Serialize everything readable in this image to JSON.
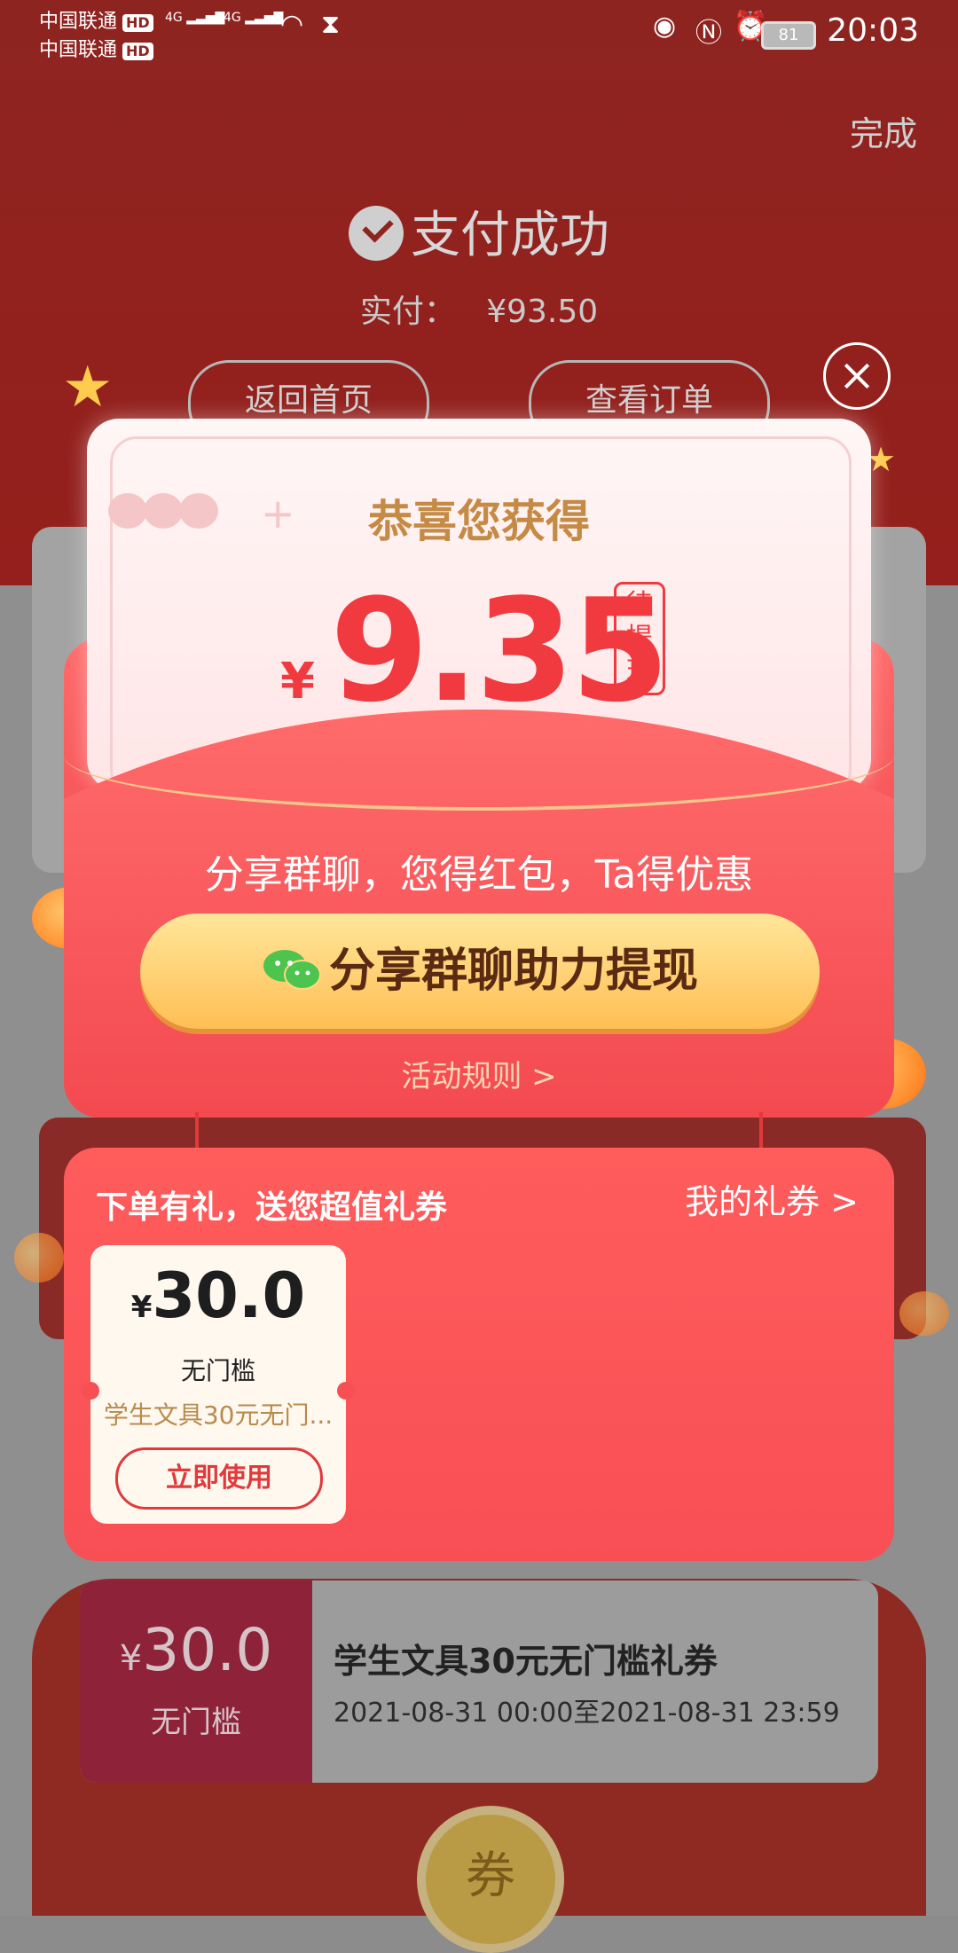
{
  "status_bar": {
    "carrier1": "中国联通",
    "carrier2": "中国联通",
    "hd": "HD",
    "network1": "4G",
    "network2": "4G",
    "battery": "81",
    "time": "20:03"
  },
  "header": {
    "done": "完成",
    "title": "支付成功",
    "paid_label": "实付：",
    "paid_amount": "¥93.50",
    "home_button": "返回首页",
    "order_button": "查看订单"
  },
  "popup": {
    "congrats": "恭喜您获得",
    "currency": "¥",
    "amount": "9.35",
    "pending_tag": "待提现",
    "share_text": "分享群聊，您得红包，Ta得优惠",
    "share_button": "分享群聊助力提现",
    "rules_link": "活动规则 >"
  },
  "gift": {
    "title": "下单有礼，送您超值礼券",
    "my_coupons": "我的礼券 >",
    "ticket": {
      "currency": "¥",
      "amount": "30.0",
      "threshold": "无门槛",
      "desc": "学生文具30元无门...",
      "use_button": "立即使用"
    }
  },
  "background_coupon": {
    "currency": "¥",
    "amount": "30.0",
    "threshold": "无门槛",
    "name": "学生文具30元无门槛礼券",
    "validity": "2021-08-31 00:00至2021-08-31 23:59",
    "badge": "券"
  },
  "colors": {
    "header_red": "#8e2420",
    "popup_red": "#f84f55",
    "amount_red": "#f13a3f",
    "gold": "#c58a43",
    "button_yellow": "#ffbf55"
  }
}
